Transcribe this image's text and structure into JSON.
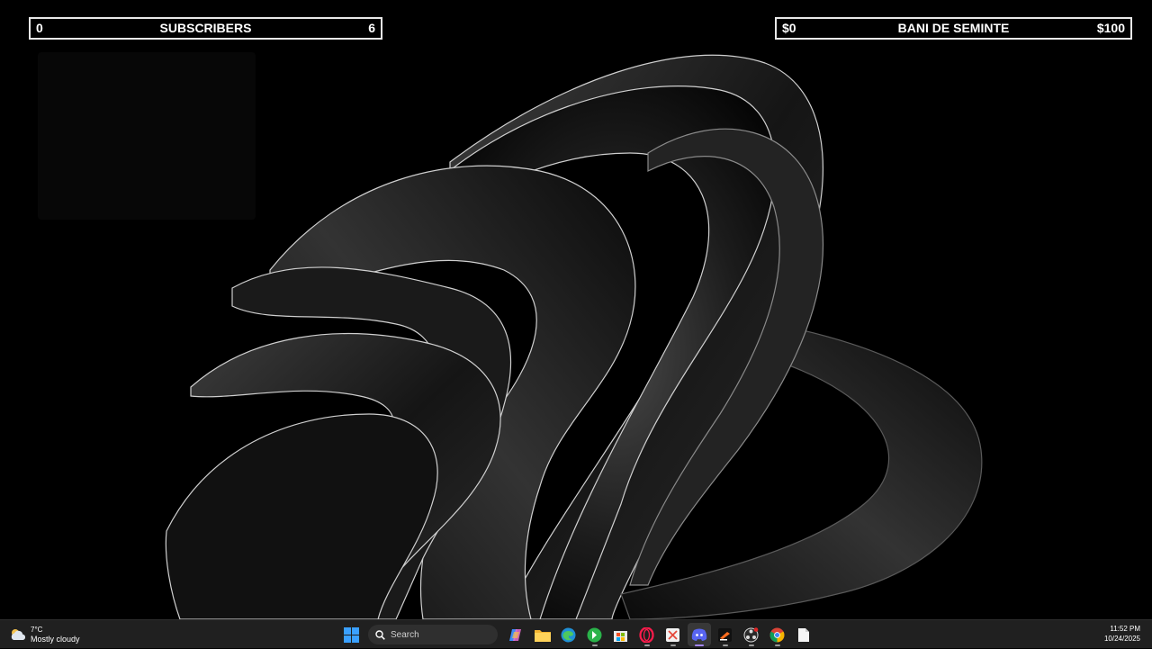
{
  "subscribers_bar": {
    "min": "0",
    "label": "SUBSCRIBERS",
    "max": "6",
    "progress": 0
  },
  "money_bar": {
    "min": "$0",
    "label": "BANI DE SEMINTE",
    "max": "$100",
    "progress": 0
  },
  "taskbar": {
    "weather": {
      "temp": "7°C",
      "condition": "Mostly cloudy",
      "icon": "cloud-sun-icon"
    },
    "search": {
      "placeholder": "Search"
    },
    "apps": [
      {
        "name": "start",
        "icon": "windows-logo-icon"
      },
      {
        "name": "copilot",
        "icon": "copilot-icon"
      },
      {
        "name": "file-explorer",
        "icon": "folder-icon"
      },
      {
        "name": "edge",
        "icon": "edge-icon"
      },
      {
        "name": "green-app",
        "icon": "green-app-icon"
      },
      {
        "name": "store",
        "icon": "store-icon"
      },
      {
        "name": "opera-gx",
        "icon": "opera-icon"
      },
      {
        "name": "snipping",
        "icon": "snip-icon"
      },
      {
        "name": "discord",
        "icon": "discord-icon",
        "active": true
      },
      {
        "name": "dev-app",
        "icon": "dev-app-icon"
      },
      {
        "name": "obs",
        "icon": "obs-icon"
      },
      {
        "name": "chrome",
        "icon": "chrome-icon"
      },
      {
        "name": "notepad",
        "icon": "document-icon"
      }
    ],
    "clock": {
      "time": "11:52 PM",
      "date": "10/24/2025"
    }
  },
  "colors": {
    "bar_border": "#e8e8e8",
    "taskbar_bg": "#202020",
    "discord": "#5865f2",
    "accent_indicator": "#a587ff"
  }
}
